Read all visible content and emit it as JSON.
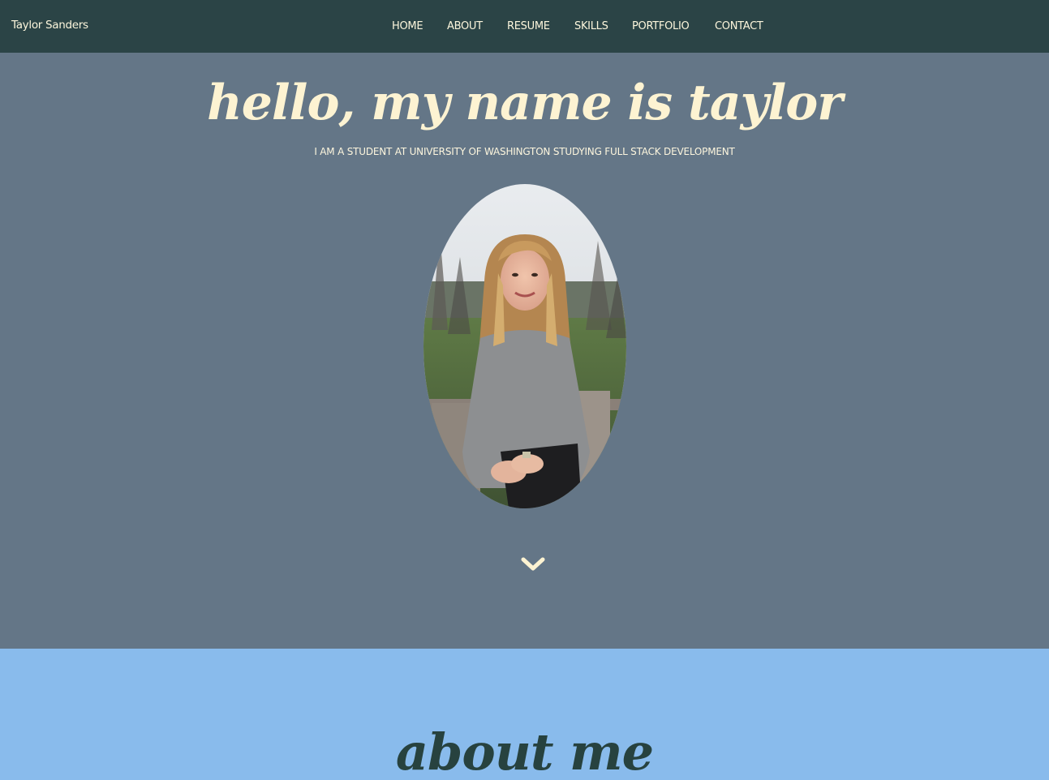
{
  "nav": {
    "brand": "Taylor Sanders",
    "items": [
      "HOME",
      "ABOUT",
      "RESUME",
      "SKILLS",
      "PORTFOLIO",
      "CONTACT"
    ]
  },
  "hero": {
    "title": "hello, my name is taylor",
    "subtitle": "I AM A STUDENT AT UNIVERSITY OF WASHINGTON STUDYING FULL STACK DEVELOPMENT",
    "scroll_icon": "chevron-down-icon"
  },
  "about": {
    "heading": "about me"
  },
  "colors": {
    "navbar": "#2b4446",
    "hero_bg": "#647687",
    "about_bg": "#89bbec",
    "cream_text": "#fdf3d2",
    "about_heading": "#27423f"
  }
}
